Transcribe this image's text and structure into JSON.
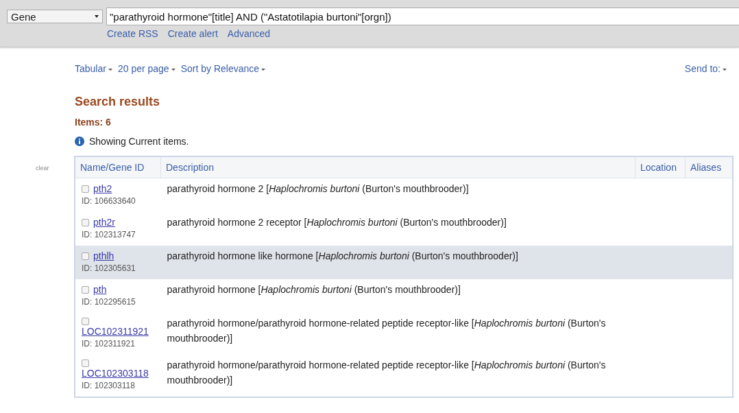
{
  "search_bar": {
    "database": "Gene",
    "query": "\"parathyroid hormone\"[title] AND (\"Astatotilapia burtoni\"[orgn])",
    "links": [
      "Create RSS",
      "Create alert",
      "Advanced"
    ]
  },
  "display_options": [
    "Tabular",
    "20 per page",
    "Sort by Relevance"
  ],
  "send_to": "Send to:",
  "heading": "Search results",
  "items_count": "Items: 6",
  "info_message": "Showing Current items.",
  "clear_link": "clear",
  "table": {
    "columns": [
      "Name/Gene ID",
      "Description",
      "Location",
      "Aliases"
    ],
    "rows": [
      {
        "name": "pth2",
        "id": "ID: 106633640",
        "description": "parathyroid hormone 2 [*Haplochromis burtoni* (Burton's mouthbrooder)]",
        "checked": false,
        "selected": false
      },
      {
        "name": "pth2r",
        "id": "ID: 102313747",
        "description": "parathyroid hormone 2 receptor [*Haplochromis burtoni* (Burton's mouthbrooder)]",
        "checked": false,
        "selected": false
      },
      {
        "name": "pthlh",
        "id": "ID: 102305631",
        "description": "parathyroid hormone like hormone [*Haplochromis burtoni* (Burton's mouthbrooder)]",
        "checked": false,
        "selected": true
      },
      {
        "name": "pth",
        "id": "ID: 102295615",
        "description": "parathyroid hormone [*Haplochromis burtoni* (Burton's mouthbrooder)]",
        "checked": false,
        "selected": false
      },
      {
        "name": "LOC102311921",
        "id": "ID: 102311921",
        "description": "parathyroid hormone/parathyroid hormone-related peptide receptor-like [*Haplochromis burtoni* (Burton's mouthbrooder)]",
        "checked": false,
        "selected": false
      },
      {
        "name": "LOC102303118",
        "id": "ID: 102303118",
        "description": "parathyroid hormone/parathyroid hormone-related peptide receptor-like [*Haplochromis burtoni* (Burton's mouthbrooder)]",
        "checked": false,
        "selected": false
      }
    ]
  }
}
